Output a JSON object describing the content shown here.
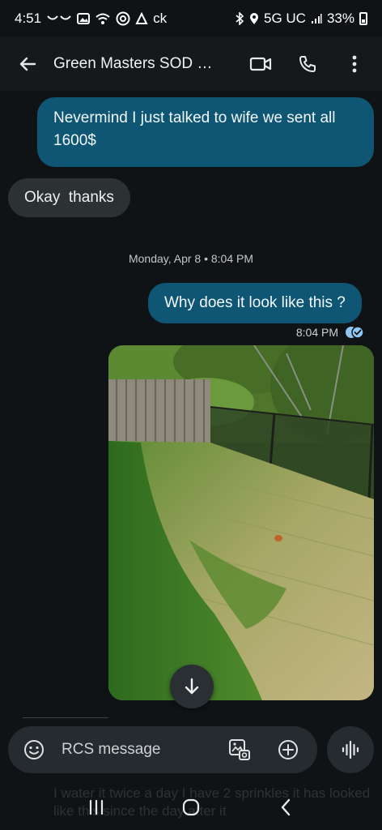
{
  "status_bar": {
    "time": "4:51",
    "carrier_tag": "ck",
    "network": "5G UC",
    "battery": "33%"
  },
  "app_bar": {
    "contact_name": "Green Masters SOD Pe...",
    "icons": [
      "back-arrow-icon",
      "video-call-icon",
      "phone-icon",
      "more-vert-icon"
    ]
  },
  "messages": [
    {
      "direction": "outgoing",
      "text": "Nevermind I just talked to wife we sent all 1600$"
    },
    {
      "direction": "incoming",
      "text": "Okay  thanks"
    },
    {
      "type": "date_separator",
      "text": "Monday, Apr 8 • 8:04 PM"
    },
    {
      "direction": "outgoing",
      "text": "Why does it look like this ?"
    },
    {
      "type": "timestamp",
      "text": "8:04 PM",
      "status": "read"
    },
    {
      "direction": "outgoing",
      "type": "image",
      "description_icon": "lawn-photo"
    }
  ],
  "composer": {
    "placeholder": "RCS message",
    "icons": [
      "emoji-icon",
      "gallery-icon",
      "add-icon",
      "voice-icon"
    ]
  },
  "ghost_preview": "I water it twice a day I have 2 sprinkles it has looked like this since the day after it",
  "colors": {
    "background": "#101316",
    "outgoing_bubble": "#0e5673",
    "incoming_bubble": "#2c3134",
    "read_receipt": "#8fc7f2"
  }
}
